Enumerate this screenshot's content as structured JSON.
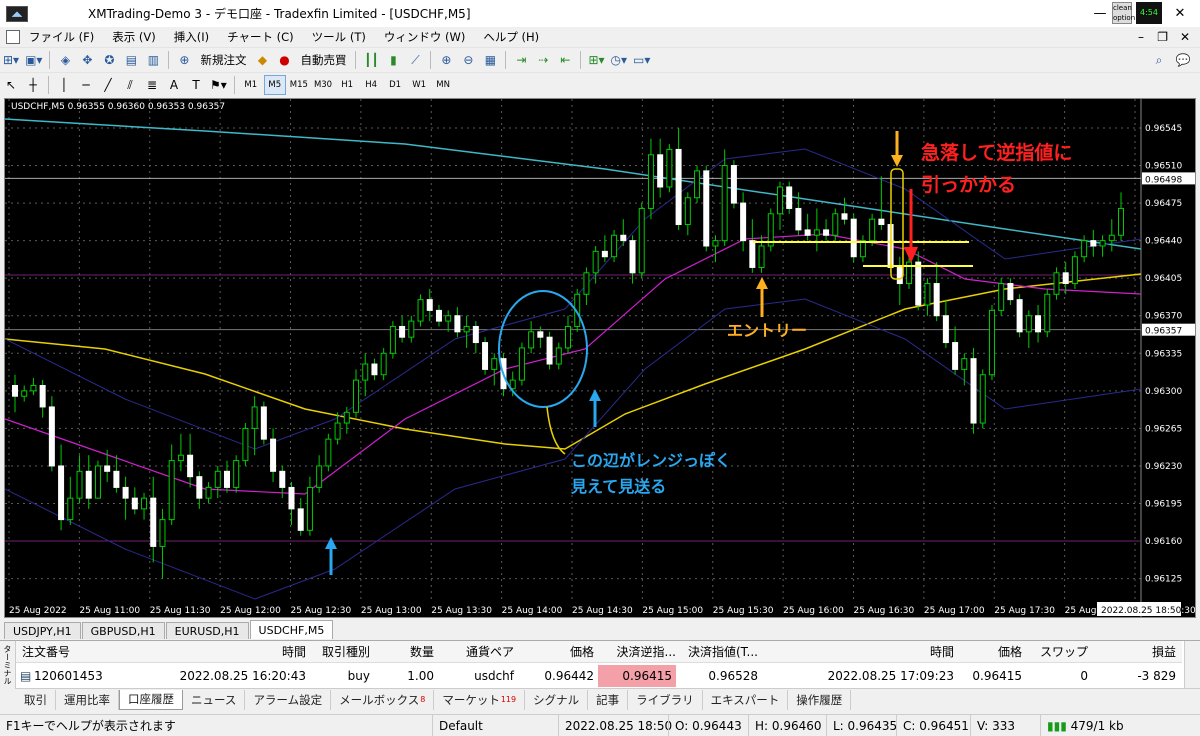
{
  "window": {
    "title": "XMTrading-Demo 3 - デモ口座 - Tradexfin Limited - [USDCHF,M5]",
    "minimize": "—",
    "maximize": "▢",
    "close": "✕",
    "icon": "chart-app-icon",
    "tray_top": "clean",
    "tray_bottom": "option",
    "tray_clock": "4:54"
  },
  "menu": [
    "ファイル (F)",
    "表示 (V)",
    "挿入(I)",
    "チャート (C)",
    "ツール (T)",
    "ウィンドウ (W)",
    "ヘルプ (H)"
  ],
  "menu_controls": {
    "min": "–",
    "restore": "❐",
    "close": "✕"
  },
  "toolbar1": {
    "new_order": "新規注文",
    "auto_trade": "自動売買"
  },
  "timeframes": [
    "M1",
    "M5",
    "M15",
    "M30",
    "H1",
    "H4",
    "D1",
    "W1",
    "MN"
  ],
  "timeframe_active": "M5",
  "chart_info": "USDCHF,M5  0.96355 0.96360 0.96353 0.96357",
  "chart_data": {
    "type": "candlestick",
    "symbol": "USDCHF",
    "timeframe": "M5",
    "ohlc_header": [
      0.96355,
      0.9636,
      0.96353,
      0.96357
    ],
    "yticks": [
      0.96545,
      0.9651,
      0.96475,
      0.9644,
      0.96405,
      0.9637,
      0.96335,
      0.963,
      0.96265,
      0.9623,
      0.96195,
      0.9616,
      0.96125
    ],
    "ylim": [
      0.96106,
      0.96572
    ],
    "price_labels": [
      {
        "label": "0.96498",
        "value": 0.96498
      },
      {
        "label": "0.96357",
        "value": 0.96357
      }
    ],
    "xticks": [
      "25 Aug 2022",
      "25 Aug 11:00",
      "25 Aug 11:30",
      "25 Aug 12:00",
      "25 Aug 12:30",
      "25 Aug 13:00",
      "25 Aug 13:30",
      "25 Aug 14:00",
      "25 Aug 14:30",
      "25 Aug 15:00",
      "25 Aug 15:30",
      "25 Aug 16:00",
      "25 Aug 16:30",
      "25 Aug 17:00",
      "25 Aug 17:30",
      "25 Aug 18:00",
      "25 Aug 18:30"
    ],
    "current_time_label": "2022.08.25 18:50",
    "annotations": [
      {
        "text": "急落して逆指値に",
        "color": "#ff2020"
      },
      {
        "text": "引っかかる",
        "color": "#ff2020"
      },
      {
        "text": "エントリー",
        "color": "#ffb020"
      },
      {
        "text": "この辺がレンジっぽく",
        "color": "#29a8f0"
      },
      {
        "text": "見えて見送る",
        "color": "#29a8f0"
      }
    ],
    "candles": [
      [
        0.96305,
        0.96315,
        0.9628,
        0.96295
      ],
      [
        0.96295,
        0.96305,
        0.9629,
        0.963
      ],
      [
        0.963,
        0.96312,
        0.96296,
        0.96305
      ],
      [
        0.96305,
        0.9631,
        0.96275,
        0.96285
      ],
      [
        0.96285,
        0.96295,
        0.96225,
        0.9623
      ],
      [
        0.9623,
        0.9625,
        0.9617,
        0.9618
      ],
      [
        0.9618,
        0.9622,
        0.96175,
        0.962
      ],
      [
        0.962,
        0.9624,
        0.96195,
        0.96225
      ],
      [
        0.96225,
        0.9624,
        0.9619,
        0.962
      ],
      [
        0.962,
        0.96235,
        0.962,
        0.9623
      ],
      [
        0.9623,
        0.96245,
        0.96215,
        0.96225
      ],
      [
        0.96225,
        0.9624,
        0.96205,
        0.9621
      ],
      [
        0.9621,
        0.9622,
        0.9618,
        0.962
      ],
      [
        0.962,
        0.9621,
        0.96185,
        0.9619
      ],
      [
        0.9619,
        0.96205,
        0.9618,
        0.962
      ],
      [
        0.962,
        0.9622,
        0.9614,
        0.96155
      ],
      [
        0.96155,
        0.9619,
        0.96125,
        0.9618
      ],
      [
        0.9618,
        0.9625,
        0.96175,
        0.96235
      ],
      [
        0.96235,
        0.9626,
        0.96225,
        0.9624
      ],
      [
        0.9624,
        0.9626,
        0.9621,
        0.9622
      ],
      [
        0.9622,
        0.96225,
        0.9619,
        0.962
      ],
      [
        0.962,
        0.96215,
        0.96195,
        0.9621
      ],
      [
        0.9621,
        0.9623,
        0.962,
        0.96225
      ],
      [
        0.96225,
        0.96235,
        0.96205,
        0.9621
      ],
      [
        0.9621,
        0.9624,
        0.96205,
        0.96235
      ],
      [
        0.96235,
        0.9627,
        0.9623,
        0.96265
      ],
      [
        0.96265,
        0.96295,
        0.9624,
        0.96285
      ],
      [
        0.96285,
        0.9629,
        0.9625,
        0.96255
      ],
      [
        0.96255,
        0.96265,
        0.96215,
        0.96225
      ],
      [
        0.96225,
        0.9623,
        0.962,
        0.9621
      ],
      [
        0.9621,
        0.96215,
        0.96175,
        0.9619
      ],
      [
        0.9619,
        0.962,
        0.96165,
        0.9617
      ],
      [
        0.9617,
        0.9622,
        0.96165,
        0.9621
      ],
      [
        0.9621,
        0.9624,
        0.96205,
        0.9623
      ],
      [
        0.9623,
        0.9626,
        0.96225,
        0.96255
      ],
      [
        0.96255,
        0.9628,
        0.9625,
        0.9627
      ],
      [
        0.9627,
        0.96285,
        0.9626,
        0.9628
      ],
      [
        0.9628,
        0.9632,
        0.96275,
        0.9631
      ],
      [
        0.9631,
        0.96335,
        0.96295,
        0.96325
      ],
      [
        0.96325,
        0.9633,
        0.9631,
        0.96315
      ],
      [
        0.96315,
        0.9634,
        0.9631,
        0.96335
      ],
      [
        0.96335,
        0.96365,
        0.9633,
        0.9636
      ],
      [
        0.9636,
        0.9637,
        0.96345,
        0.9635
      ],
      [
        0.9635,
        0.9637,
        0.96345,
        0.96365
      ],
      [
        0.96365,
        0.9639,
        0.9636,
        0.96385
      ],
      [
        0.96385,
        0.96395,
        0.96365,
        0.96375
      ],
      [
        0.96375,
        0.9638,
        0.9636,
        0.96365
      ],
      [
        0.96365,
        0.96375,
        0.96355,
        0.9637
      ],
      [
        0.9637,
        0.96378,
        0.9635,
        0.96355
      ],
      [
        0.96355,
        0.9637,
        0.9634,
        0.9636
      ],
      [
        0.9636,
        0.96365,
        0.96335,
        0.96345
      ],
      [
        0.96345,
        0.9635,
        0.96315,
        0.9632
      ],
      [
        0.9632,
        0.96335,
        0.96305,
        0.9633
      ],
      [
        0.9633,
        0.96335,
        0.96295,
        0.96302
      ],
      [
        0.96302,
        0.96318,
        0.96295,
        0.9631
      ],
      [
        0.9631,
        0.96345,
        0.96305,
        0.9634
      ],
      [
        0.9634,
        0.96365,
        0.96335,
        0.96355
      ],
      [
        0.96355,
        0.9636,
        0.9634,
        0.9635
      ],
      [
        0.9635,
        0.96355,
        0.9632,
        0.96325
      ],
      [
        0.96325,
        0.96345,
        0.9632,
        0.9634
      ],
      [
        0.9634,
        0.9637,
        0.96335,
        0.9636
      ],
      [
        0.9636,
        0.96395,
        0.96355,
        0.9639
      ],
      [
        0.9639,
        0.96415,
        0.9638,
        0.9641
      ],
      [
        0.9641,
        0.96435,
        0.964,
        0.9643
      ],
      [
        0.9643,
        0.96445,
        0.9642,
        0.96425
      ],
      [
        0.96425,
        0.9645,
        0.9642,
        0.96445
      ],
      [
        0.96445,
        0.9646,
        0.96435,
        0.9644
      ],
      [
        0.9644,
        0.96445,
        0.964,
        0.9641
      ],
      [
        0.9641,
        0.96475,
        0.96405,
        0.9647
      ],
      [
        0.9647,
        0.96535,
        0.9646,
        0.9652
      ],
      [
        0.9652,
        0.96535,
        0.9648,
        0.9649
      ],
      [
        0.9649,
        0.9653,
        0.96485,
        0.96525
      ],
      [
        0.96525,
        0.96545,
        0.9645,
        0.96455
      ],
      [
        0.96455,
        0.96485,
        0.96445,
        0.9648
      ],
      [
        0.9648,
        0.9651,
        0.96475,
        0.96505
      ],
      [
        0.96505,
        0.9651,
        0.9643,
        0.96435
      ],
      [
        0.96435,
        0.96445,
        0.9642,
        0.9644
      ],
      [
        0.9644,
        0.96525,
        0.96435,
        0.9651
      ],
      [
        0.9651,
        0.96515,
        0.9647,
        0.96475
      ],
      [
        0.96475,
        0.96485,
        0.9643,
        0.9644
      ],
      [
        0.9644,
        0.9646,
        0.9641,
        0.96415
      ],
      [
        0.96415,
        0.96445,
        0.9641,
        0.96435
      ],
      [
        0.96435,
        0.9647,
        0.9643,
        0.96465
      ],
      [
        0.96465,
        0.96495,
        0.9645,
        0.9649
      ],
      [
        0.9649,
        0.96495,
        0.96465,
        0.9647
      ],
      [
        0.9647,
        0.96485,
        0.96445,
        0.9645
      ],
      [
        0.9645,
        0.96465,
        0.9644,
        0.96445
      ],
      [
        0.96445,
        0.9647,
        0.9643,
        0.9645
      ],
      [
        0.9645,
        0.9646,
        0.9644,
        0.96445
      ],
      [
        0.96445,
        0.9647,
        0.9644,
        0.96465
      ],
      [
        0.96465,
        0.9648,
        0.96455,
        0.9646
      ],
      [
        0.9646,
        0.96465,
        0.9642,
        0.96425
      ],
      [
        0.96425,
        0.96445,
        0.9642,
        0.9644
      ],
      [
        0.9644,
        0.96465,
        0.96435,
        0.9646
      ],
      [
        0.9646,
        0.965,
        0.9645,
        0.96455
      ],
      [
        0.96455,
        0.9646,
        0.9641,
        0.96415
      ],
      [
        0.96415,
        0.96425,
        0.9638,
        0.964
      ],
      [
        0.964,
        0.96425,
        0.96395,
        0.9642
      ],
      [
        0.9642,
        0.9643,
        0.96375,
        0.9638
      ],
      [
        0.9638,
        0.96405,
        0.9637,
        0.964
      ],
      [
        0.964,
        0.9642,
        0.96365,
        0.9637
      ],
      [
        0.9637,
        0.96385,
        0.9634,
        0.96345
      ],
      [
        0.96345,
        0.9636,
        0.96315,
        0.9632
      ],
      [
        0.9632,
        0.96335,
        0.96305,
        0.9633
      ],
      [
        0.9633,
        0.9634,
        0.9626,
        0.9627
      ],
      [
        0.9627,
        0.9632,
        0.96265,
        0.96315
      ],
      [
        0.96315,
        0.9638,
        0.9631,
        0.96375
      ],
      [
        0.96375,
        0.96405,
        0.9637,
        0.964
      ],
      [
        0.964,
        0.96405,
        0.9638,
        0.96385
      ],
      [
        0.96385,
        0.9639,
        0.9635,
        0.96355
      ],
      [
        0.96355,
        0.96375,
        0.9634,
        0.9637
      ],
      [
        0.9637,
        0.9638,
        0.96345,
        0.96355
      ],
      [
        0.96355,
        0.96395,
        0.9635,
        0.9639
      ],
      [
        0.9639,
        0.96415,
        0.96385,
        0.9641
      ],
      [
        0.9641,
        0.9642,
        0.9639,
        0.964
      ],
      [
        0.964,
        0.9643,
        0.96395,
        0.96425
      ],
      [
        0.96425,
        0.96445,
        0.9642,
        0.9644
      ],
      [
        0.9644,
        0.9645,
        0.96425,
        0.96435
      ],
      [
        0.96435,
        0.96445,
        0.96425,
        0.9644
      ],
      [
        0.9644,
        0.9646,
        0.9643,
        0.96445
      ],
      [
        0.96445,
        0.96485,
        0.9644,
        0.9647
      ]
    ]
  },
  "symbol_tabs": [
    "USDJPY,H1",
    "GBPUSD,H1",
    "EURUSD,H1",
    "USDCHF,M5"
  ],
  "symbol_tab_active": "USDCHF,M5",
  "terminal": {
    "side_label": "ターミナル",
    "headers": [
      "注文番号",
      "時間",
      "取引種別",
      "数量",
      "通貨ペア",
      "価格",
      "決済逆指...",
      "決済指値(T...",
      "時間",
      "価格",
      "スワップ",
      "損益"
    ],
    "row": {
      "ticket": "120601453",
      "time": "2022.08.25 16:20:43",
      "type": "buy",
      "volume": "1.00",
      "symbol": "usdchf",
      "price": "0.96442",
      "sl": "0.96415",
      "tp": "0.96528",
      "close_time": "2022.08.25 17:09:23",
      "close_price": "0.96415",
      "swap": "0",
      "profit": "-3 829"
    }
  },
  "bottom_tabs": [
    {
      "label": "取引"
    },
    {
      "label": "運用比率"
    },
    {
      "label": "口座履歴"
    },
    {
      "label": "ニュース"
    },
    {
      "label": "アラーム設定"
    },
    {
      "label": "メールボックス",
      "badge": "8"
    },
    {
      "label": "マーケット",
      "badge": "119"
    },
    {
      "label": "シグナル"
    },
    {
      "label": "記事"
    },
    {
      "label": "ライブラリ"
    },
    {
      "label": "エキスパート"
    },
    {
      "label": "操作履歴"
    }
  ],
  "bottom_tab_active": "口座履歴",
  "status": {
    "help": "F1キーでヘルプが表示されます",
    "profile": "Default",
    "datetime": "2022.08.25 18:50",
    "open": "O: 0.96443",
    "high": "H: 0.96460",
    "low": "L: 0.96435",
    "close": "C: 0.96451",
    "volume": "V: 333",
    "traffic": "479/1 kb"
  },
  "colors": {
    "chart_bg": "#000000",
    "grid": "#5a5a5a",
    "bull": "#00cc00",
    "bear": "#ffffff",
    "ma_yellow": "#e8d000",
    "ma_cyan": "#3fb8c8",
    "ma_magenta": "#d020d0",
    "band": "#2a2a90",
    "annotation_red": "#ff2020",
    "annotation_orange": "#ffb020",
    "annotation_blue": "#29a8f0"
  }
}
